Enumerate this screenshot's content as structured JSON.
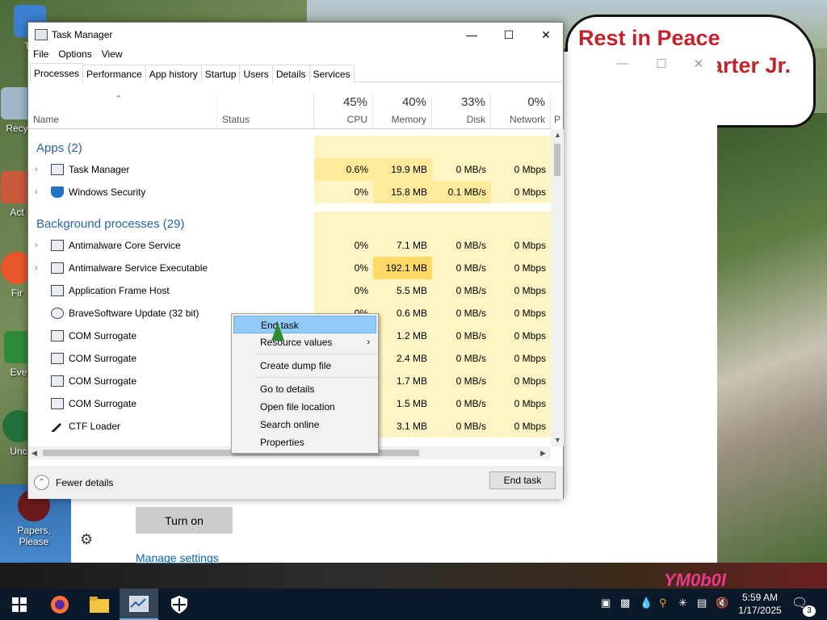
{
  "desktop": {
    "speech_bubble": {
      "line1": "Rest in Peace",
      "line2": "arter Jr."
    },
    "icons": [
      {
        "label": "Th"
      },
      {
        "label": "Recy"
      },
      {
        "label": "Act"
      },
      {
        "label": "Fir"
      },
      {
        "label": "Ever"
      },
      {
        "label": "Unc"
      },
      {
        "label": "Papers, Please"
      }
    ],
    "background_window": {
      "turn_on_label": "Turn on",
      "manage_settings_label": "Manage settings"
    },
    "watermark": "YM0b0I"
  },
  "task_manager": {
    "title": "Task Manager",
    "menu": [
      "File",
      "Options",
      "View"
    ],
    "tabs": [
      "Processes",
      "Performance",
      "App history",
      "Startup",
      "Users",
      "Details",
      "Services"
    ],
    "active_tab": "Processes",
    "columns": {
      "name": "Name",
      "status": "Status",
      "cpu": {
        "label": "CPU",
        "percent": "45%"
      },
      "memory": {
        "label": "Memory",
        "percent": "40%"
      },
      "disk": {
        "label": "Disk",
        "percent": "33%"
      },
      "network": {
        "label": "Network",
        "percent": "0%"
      },
      "power_partial": "P"
    },
    "groups": {
      "apps": "Apps (2)",
      "background": "Background processes (29)"
    },
    "apps": [
      {
        "name": "Task Manager",
        "cpu": "0.6%",
        "memory": "19.9 MB",
        "disk": "0 MB/s",
        "network": "0 Mbps"
      },
      {
        "name": "Windows Security",
        "cpu": "0%",
        "memory": "15.8 MB",
        "disk": "0.1 MB/s",
        "network": "0 Mbps"
      }
    ],
    "background": [
      {
        "name": "Antimalware Core Service",
        "cpu": "0%",
        "memory": "7.1 MB",
        "disk": "0 MB/s",
        "network": "0 Mbps"
      },
      {
        "name": "Antimalware Service Executable",
        "cpu": "0%",
        "memory": "192.1 MB",
        "disk": "0 MB/s",
        "network": "0 Mbps"
      },
      {
        "name": "Application Frame Host",
        "cpu": "0%",
        "memory": "5.5 MB",
        "disk": "0 MB/s",
        "network": "0 Mbps"
      },
      {
        "name": "BraveSoftware Update (32 bit)",
        "cpu": "0%",
        "memory": "0.6 MB",
        "disk": "0 MB/s",
        "network": "0 Mbps"
      },
      {
        "name": "COM Surrogate",
        "cpu": "",
        "memory": "1.2 MB",
        "disk": "0 MB/s",
        "network": "0 Mbps"
      },
      {
        "name": "COM Surrogate",
        "cpu": "",
        "memory": "2.4 MB",
        "disk": "0 MB/s",
        "network": "0 Mbps"
      },
      {
        "name": "COM Surrogate",
        "cpu": "",
        "memory": "1.7 MB",
        "disk": "0 MB/s",
        "network": "0 Mbps"
      },
      {
        "name": "COM Surrogate",
        "cpu": "",
        "memory": "1.5 MB",
        "disk": "0 MB/s",
        "network": "0 Mbps"
      },
      {
        "name": "CTF Loader",
        "cpu": "",
        "memory": "3.1 MB",
        "disk": "0 MB/s",
        "network": "0 Mbps"
      }
    ],
    "context_menu": [
      "End task",
      "Resource values",
      "Create dump file",
      "Go to details",
      "Open file location",
      "Search online",
      "Properties"
    ],
    "footer": {
      "fewer_details": "Fewer details",
      "end_task": "End task"
    }
  },
  "taskbar": {
    "clock_time": "5:59 AM",
    "clock_date": "1/17/2025",
    "notification_count": "3"
  },
  "colors": {
    "accent_blue": "#2a65a8",
    "heat_light": "#fff4c4",
    "heat_medium": "#ffe99a",
    "heat_strong": "#ffd966",
    "context_highlight": "#91c9f7"
  }
}
